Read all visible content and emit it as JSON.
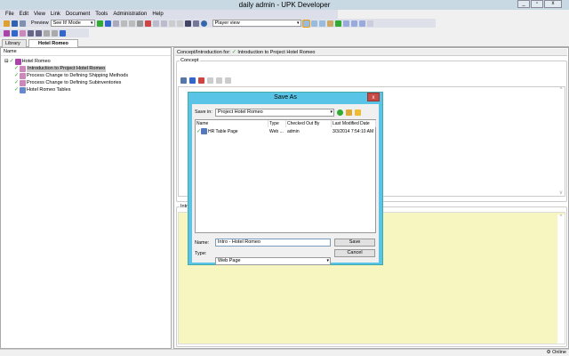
{
  "window": {
    "title": "daily admin - UPK Developer",
    "minimize": "_",
    "restore": "▫",
    "close": "x"
  },
  "menu": [
    "File",
    "Edit",
    "View",
    "Link",
    "Document",
    "Tools",
    "Administration",
    "Help"
  ],
  "toolbar": {
    "preview_label": "Preview",
    "mode_value": "See It! Mode",
    "view_value": "Player view"
  },
  "tabs": [
    {
      "label": "Library"
    },
    {
      "label": "Hotel Romeo"
    }
  ],
  "tree": {
    "header": "Name",
    "root": "Hotel Romeo",
    "items": [
      "Introduction to Project Hotel Romeo",
      "Process Change to Defining Shipping Methods",
      "Process Change to Defining Subinventories",
      "Hotel Romeo Tables"
    ]
  },
  "editor": {
    "header_label": "Concept/Introduction for:",
    "header_doc": "Introduction to Project Hotel Romeo",
    "concept_label": "Concept",
    "intro_label": "Introduction"
  },
  "status": {
    "online": "Online"
  },
  "dialog": {
    "title": "Save As",
    "close": "x",
    "save_in_label": "Save in:",
    "save_in_value": "Project Hotel Romeo",
    "columns": [
      "Name",
      "Type",
      "Checked Out By",
      "Last Modified Date"
    ],
    "rows": [
      {
        "name": "HR Table Page",
        "type": "Web ...",
        "checked_out_by": "admin",
        "modified": "3/3/2014 7:54:10 AM"
      }
    ],
    "name_label": "Name:",
    "name_value": "Intro - Hotel Romeo",
    "type_label": "Type:",
    "type_value": "Web Page",
    "save": "Save",
    "cancel": "Cancel"
  }
}
